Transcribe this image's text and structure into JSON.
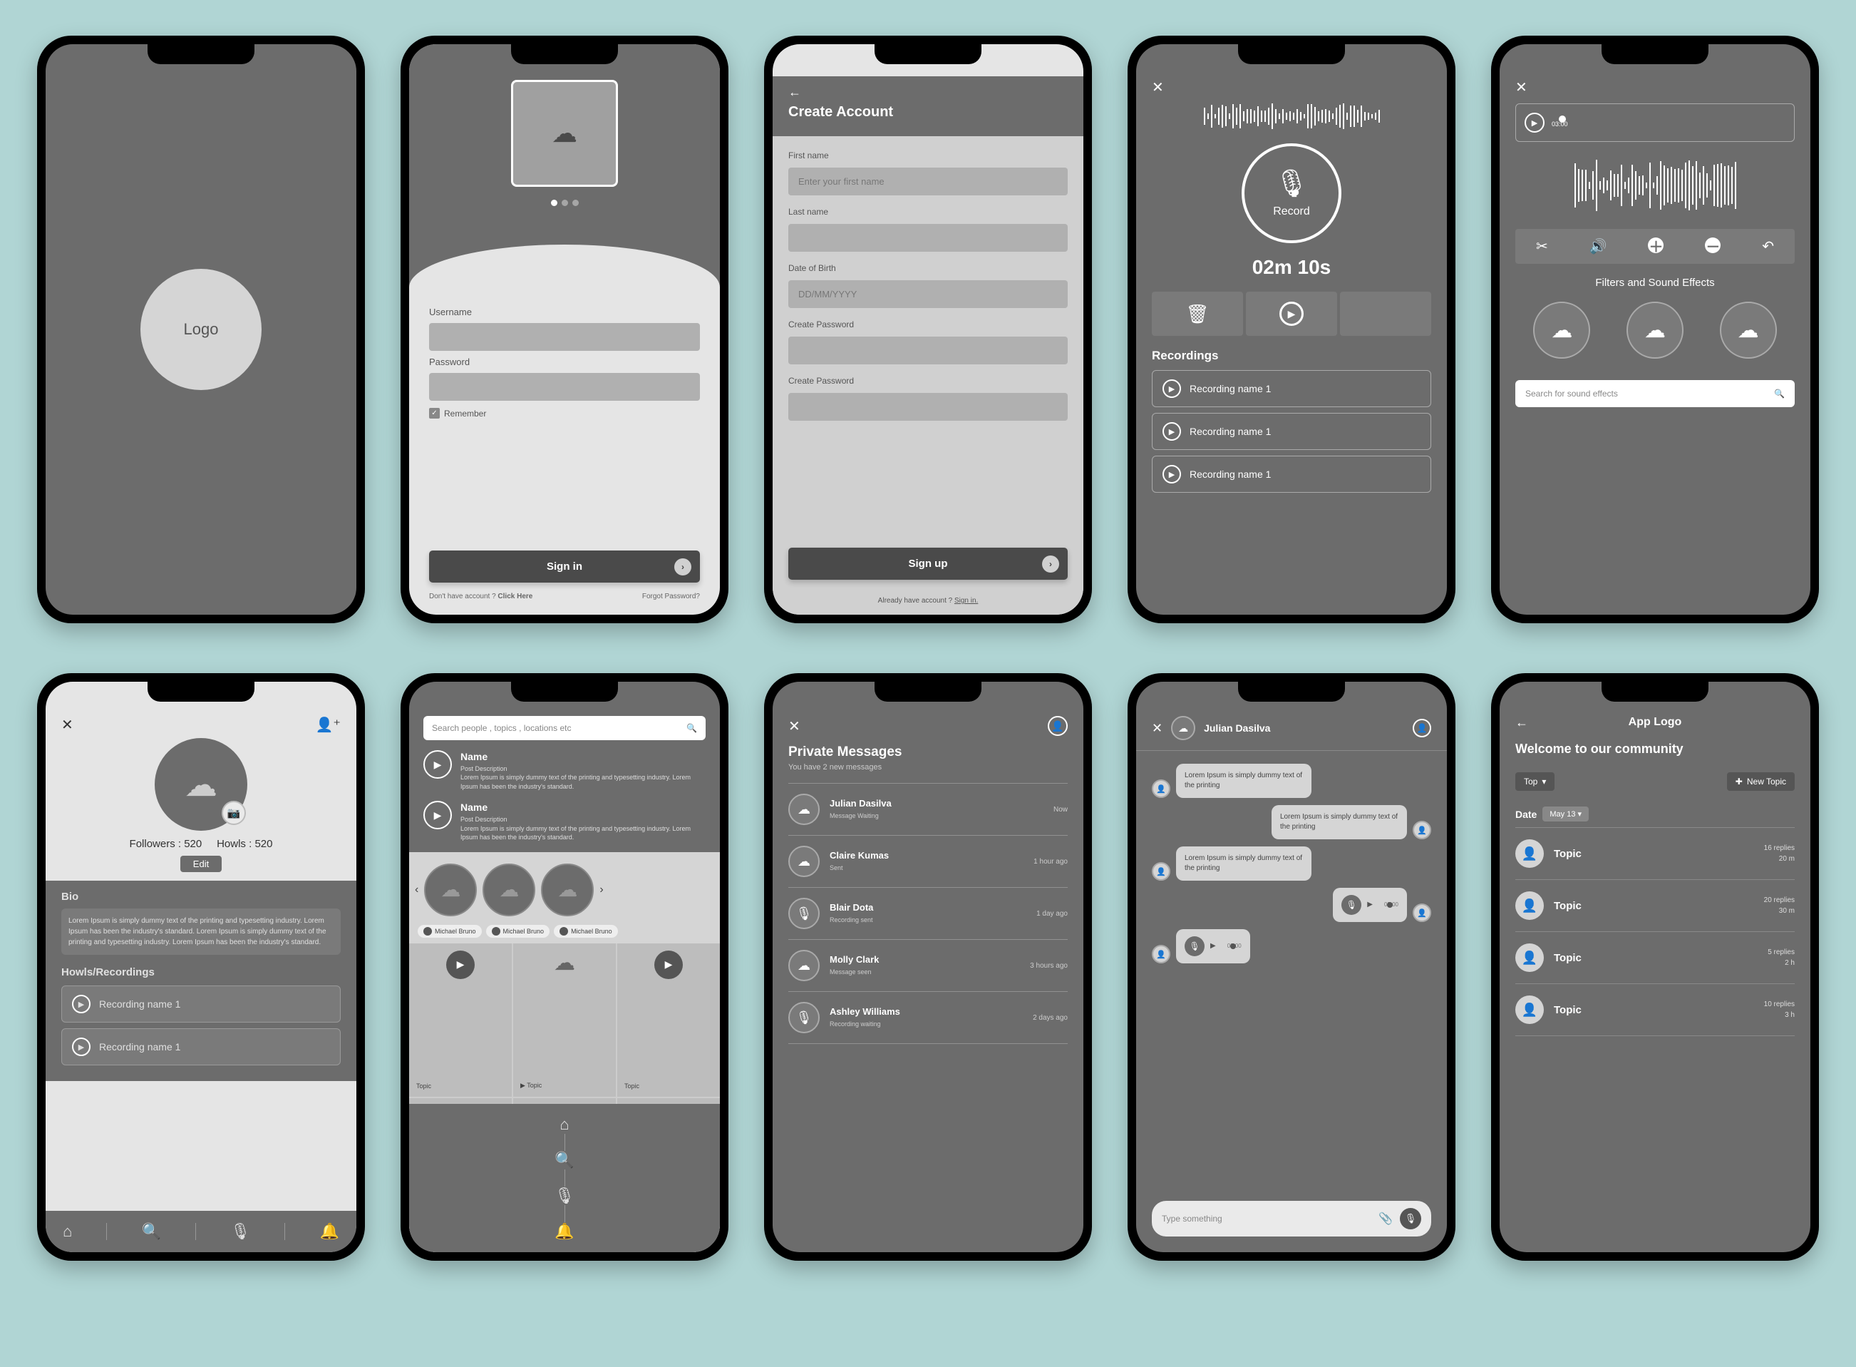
{
  "splash": {
    "logo": "Logo"
  },
  "login": {
    "username_label": "Username",
    "password_label": "Password",
    "remember": "Remember",
    "button": "Sign in",
    "no_account": "Don't have account ? ",
    "click_here": "Click Here",
    "forgot": "Forgot Password?"
  },
  "signup": {
    "title": "Create Account",
    "first_name_label": "First name",
    "first_name_placeholder": "Enter your first name",
    "last_name_label": "Last name",
    "dob_label": "Date of Birth",
    "dob_placeholder": "DD/MM/YYYY",
    "pw1_label": "Create Password",
    "pw2_label": "Create Password",
    "button": "Sign up",
    "already": "Already have account ? ",
    "signin_link": "Sign in."
  },
  "recorder": {
    "record_label": "Record",
    "timer": "02m 10s",
    "section": "Recordings",
    "items": [
      "Recording name 1",
      "Recording name 1",
      "Recording name 1"
    ]
  },
  "editor": {
    "time": "03:00",
    "filters_title": "Filters and Sound Effects",
    "search_placeholder": "Search for sound effects"
  },
  "profile": {
    "followers_label": "Followers : ",
    "followers_count": "520",
    "howls_label": "Howls : ",
    "howls_count": "520",
    "edit": "Edit",
    "bio_title": "Bio",
    "bio_text": "Lorem Ipsum is simply dummy text of the printing and typesetting industry. Lorem Ipsum has been the industry's standard.\nLorem Ipsum is simply dummy text of the printing and typesetting industry. Lorem Ipsum has been the industry's standard.",
    "howls_section": "Howls/Recordings",
    "recordings": [
      "Recording name 1",
      "Recording name 1"
    ]
  },
  "feed": {
    "search_placeholder": "Search people , topics , locations etc",
    "post_name": "Name",
    "post_sub": "Post Description",
    "post_text": "Lorem Ipsum is simply dummy text of the printing and typesetting industry. Lorem Ipsum has been the industry's standard.",
    "chip_name": "Michael Bruno",
    "topic_label": "Topic"
  },
  "inbox": {
    "title": "Private Messages",
    "subtitle": "You have 2 new messages",
    "items": [
      {
        "name": "Julian Dasilva",
        "status": "Message Waiting",
        "time": "Now",
        "icon": "cloud"
      },
      {
        "name": "Claire Kumas",
        "status": "Sent",
        "time": "1 hour ago",
        "icon": "cloud"
      },
      {
        "name": "Blair Dota",
        "status": "Recording sent",
        "time": "1 day ago",
        "icon": "mic"
      },
      {
        "name": "Molly Clark",
        "status": "Message seen",
        "time": "3 hours ago",
        "icon": "cloud"
      },
      {
        "name": "Ashley Williams",
        "status": "Recording waiting",
        "time": "2 days ago",
        "icon": "mic"
      }
    ]
  },
  "chat": {
    "contact": "Julian Dasilva",
    "msg1": "Lorem Ipsum is simply dummy text of the printing",
    "msg2": "Lorem Ipsum is simply dummy text of the printing",
    "msg3": "Lorem Ipsum is simply dummy text of the printing",
    "voice_time": "03:00",
    "input_placeholder": "Type something"
  },
  "community": {
    "logo": "App Logo",
    "welcome": "Welcome to our community",
    "sort": "Top",
    "new_topic": "New Topic",
    "date_label": "Date",
    "date_value": "May 13",
    "topics": [
      {
        "name": "Topic",
        "replies": "16 replies",
        "age": "20 m"
      },
      {
        "name": "Topic",
        "replies": "20 replies",
        "age": "30 m"
      },
      {
        "name": "Topic",
        "replies": "5 replies",
        "age": "2 h"
      },
      {
        "name": "Topic",
        "replies": "10 replies",
        "age": "3 h"
      }
    ]
  }
}
